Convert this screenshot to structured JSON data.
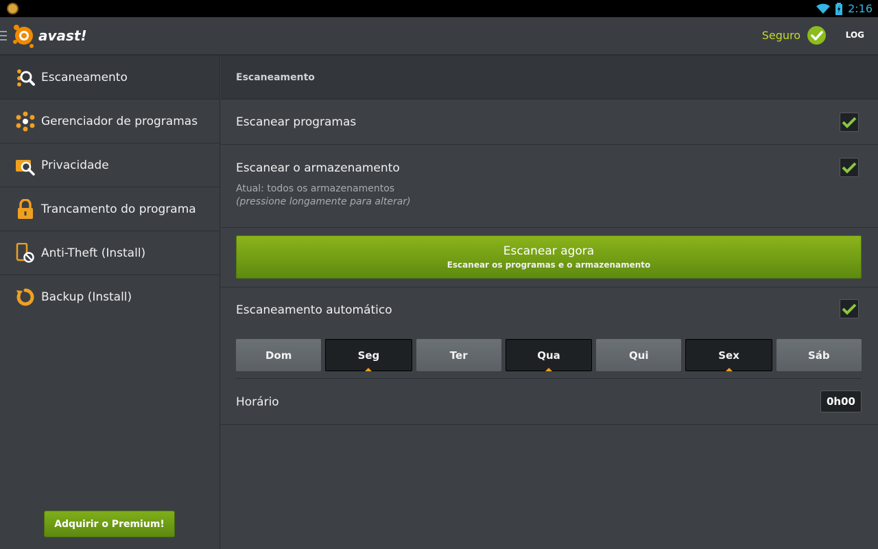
{
  "status_bar": {
    "time": "2:16"
  },
  "app": {
    "logo_text": "avast!",
    "status": "Seguro",
    "log_label": "LOG"
  },
  "sidebar": {
    "items": [
      {
        "label": "Escaneamento",
        "icon": "scan-icon",
        "active": true
      },
      {
        "label": "Gerenciador de programas",
        "icon": "app-manager-icon"
      },
      {
        "label": "Privacidade",
        "icon": "privacy-icon"
      },
      {
        "label": "Trancamento do programa",
        "icon": "lock-icon"
      },
      {
        "label": "Anti-Theft (Install)",
        "icon": "anti-theft-icon"
      },
      {
        "label": "Backup (Install)",
        "icon": "backup-icon"
      }
    ],
    "premium_button": "Adquirir o Premium!"
  },
  "main": {
    "section_title": "Escaneamento",
    "scan_apps": {
      "label": "Escanear programas",
      "checked": true
    },
    "scan_storage": {
      "label": "Escanear o armazenamento",
      "checked": true,
      "current": "Atual: todos os armazenamentos",
      "hint": "(pressione longamente para alterar)"
    },
    "scan_now": {
      "title": "Escanear agora",
      "subtitle": "Escanear os programas e o armazenamento"
    },
    "auto_scan": {
      "label": "Escaneamento automático",
      "checked": true
    },
    "days": [
      {
        "label": "Dom",
        "selected": false
      },
      {
        "label": "Seg",
        "selected": true
      },
      {
        "label": "Ter",
        "selected": false
      },
      {
        "label": "Qua",
        "selected": true
      },
      {
        "label": "Qui",
        "selected": false
      },
      {
        "label": "Sex",
        "selected": true
      },
      {
        "label": "Sáb",
        "selected": false
      }
    ],
    "schedule": {
      "label": "Horário",
      "value": "0h00"
    }
  },
  "colors": {
    "accent_green": "#8cbc1d",
    "status_yellow": "#c5d928",
    "brand_orange": "#f0a020"
  }
}
